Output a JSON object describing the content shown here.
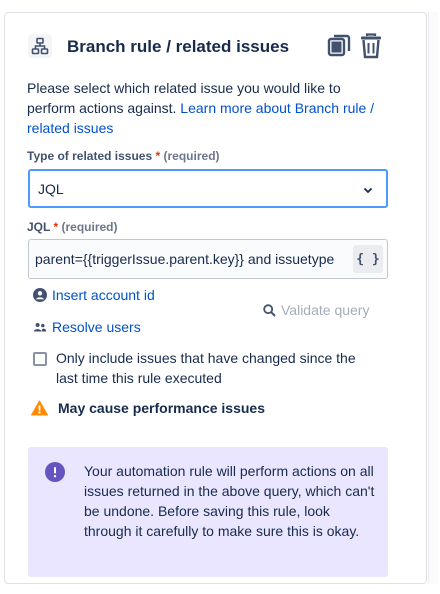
{
  "header": {
    "title": "Branch rule / related issues",
    "icon": "branch-icon",
    "copy_icon": "copy-icon",
    "delete_icon": "trash-icon"
  },
  "description": {
    "text": "Please select which related issue you would like to perform actions against. ",
    "link": "Learn more about Branch rule / related issues"
  },
  "type_field": {
    "label": "Type of related issues",
    "required_star": "*",
    "required_text": "(required)",
    "value": "JQL"
  },
  "jql_field": {
    "label": "JQL",
    "required_star": "*",
    "required_text": "(required)",
    "value": "parent={{triggerIssue.parent.key}} and issuetype",
    "smart_values_button": "{ }"
  },
  "actions": {
    "insert_account_id": "Insert account id",
    "resolve_users": "Resolve users",
    "validate_query": "Validate query"
  },
  "checkbox": {
    "label": "Only include issues that have changed since the last time this rule executed",
    "checked": false
  },
  "warning": {
    "text": "May cause performance issues"
  },
  "info": {
    "text": "Your automation rule will perform actions on all issues returned in the above query, which can't be undone. Before saving this rule, look through it carefully to make sure this is okay."
  },
  "colors": {
    "link": "#0052cc",
    "focus_border": "#4c9aff",
    "required": "#de350b",
    "warning": "#ff8b00",
    "info_bg": "#eae6ff",
    "info_icon": "#6554c0"
  }
}
